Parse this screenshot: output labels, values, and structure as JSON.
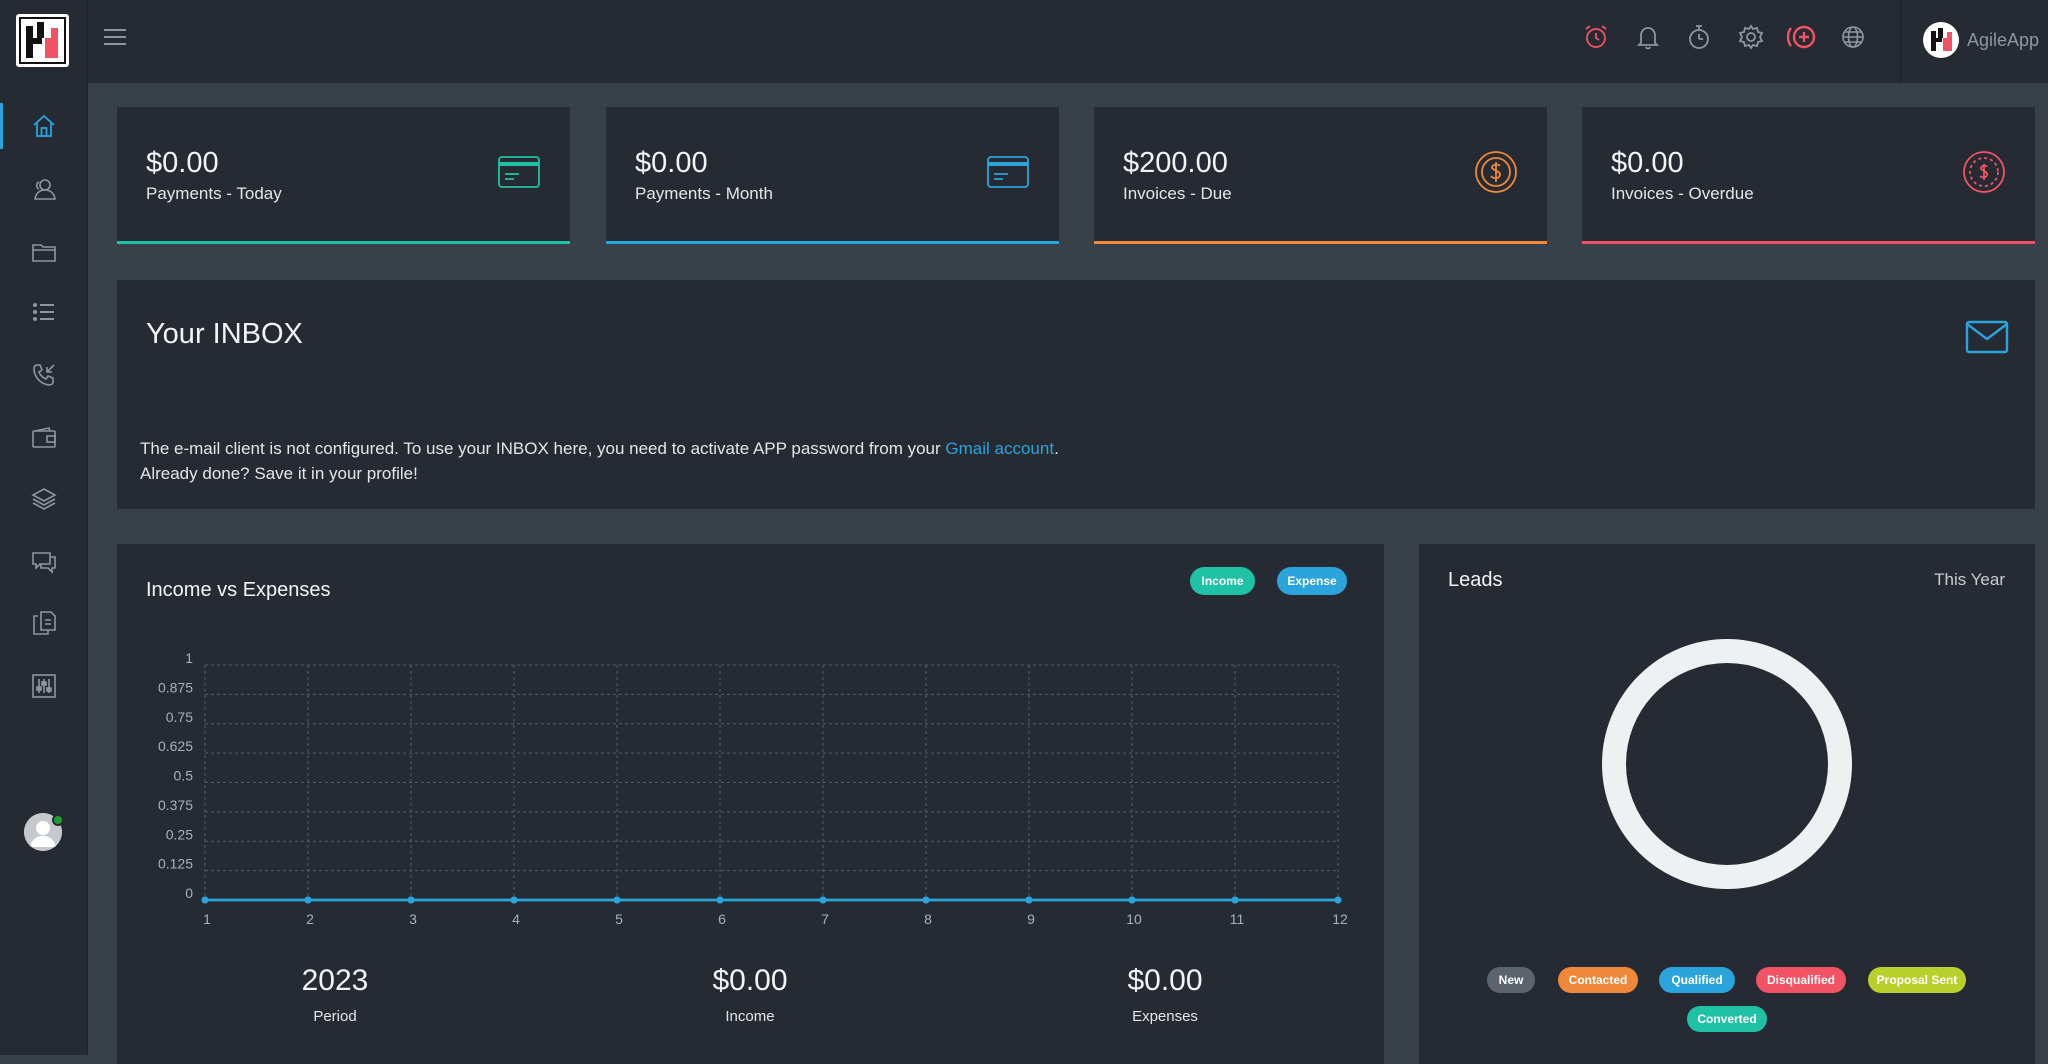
{
  "app": {
    "user_name": "AgileApp"
  },
  "stats": [
    {
      "value": "$0.00",
      "label": "Payments - Today",
      "color": "#1fc2a5",
      "icon": "credit-card-icon"
    },
    {
      "value": "$0.00",
      "label": "Payments - Month",
      "color": "#2ba3db",
      "icon": "credit-card-icon"
    },
    {
      "value": "$200.00",
      "label": "Invoices - Due",
      "color": "#f0883a",
      "icon": "dollar-coin-icon"
    },
    {
      "value": "$0.00",
      "label": "Invoices - Overdue",
      "color": "#f25364",
      "icon": "dollar-dashed-coin-icon"
    }
  ],
  "inbox": {
    "title": "Your INBOX",
    "message_before_link": "The e-mail client is not configured. To use your INBOX here, you need to activate APP password from your ",
    "link_text": "Gmail account",
    "message_after_link": ".",
    "message_line2": "Already done? Save it in your profile!"
  },
  "income_chart": {
    "title": "Income vs Expenses",
    "legend_income": "Income",
    "legend_expense": "Expense",
    "summary": [
      {
        "value": "2023",
        "label": "Period"
      },
      {
        "value": "$0.00",
        "label": "Income"
      },
      {
        "value": "$0.00",
        "label": "Expenses"
      }
    ]
  },
  "chart_data": {
    "type": "line",
    "title": "Income vs Expenses",
    "x": [
      1,
      2,
      3,
      4,
      5,
      6,
      7,
      8,
      9,
      10,
      11,
      12
    ],
    "y_ticks": [
      "1",
      "0.875",
      "0.75",
      "0.625",
      "0.5",
      "0.375",
      "0.25",
      "0.125",
      "0"
    ],
    "ylim": [
      0,
      1
    ],
    "grid": true,
    "series": [
      {
        "name": "Income",
        "color": "#1fc2a5",
        "values": [
          0,
          0,
          0,
          0,
          0,
          0,
          0,
          0,
          0,
          0,
          0,
          0
        ]
      },
      {
        "name": "Expense",
        "color": "#2ba3db",
        "values": [
          0,
          0,
          0,
          0,
          0,
          0,
          0,
          0,
          0,
          0,
          0,
          0
        ]
      }
    ]
  },
  "leads": {
    "title": "Leads",
    "period": "This Year",
    "statuses": [
      {
        "label": "New",
        "color": "#5b636d"
      },
      {
        "label": "Contacted",
        "color": "#f0883a"
      },
      {
        "label": "Qualified",
        "color": "#2ba3db"
      },
      {
        "label": "Disqualified",
        "color": "#f25364"
      },
      {
        "label": "Proposal Sent",
        "color": "#b9cf2c"
      },
      {
        "label": "Converted",
        "color": "#1fc2a5"
      }
    ]
  },
  "topbar_icons": [
    "alarm-clock-icon",
    "bell-icon",
    "stopwatch-icon",
    "gear-icon",
    "add-circle-icon",
    "globe-icon"
  ],
  "sidebar_icons": [
    "home-icon",
    "contacts-icon",
    "folder-icon",
    "list-icon",
    "phone-incoming-icon",
    "wallet-icon",
    "layers-icon",
    "chat-icon",
    "documents-icon",
    "sliders-icon"
  ]
}
